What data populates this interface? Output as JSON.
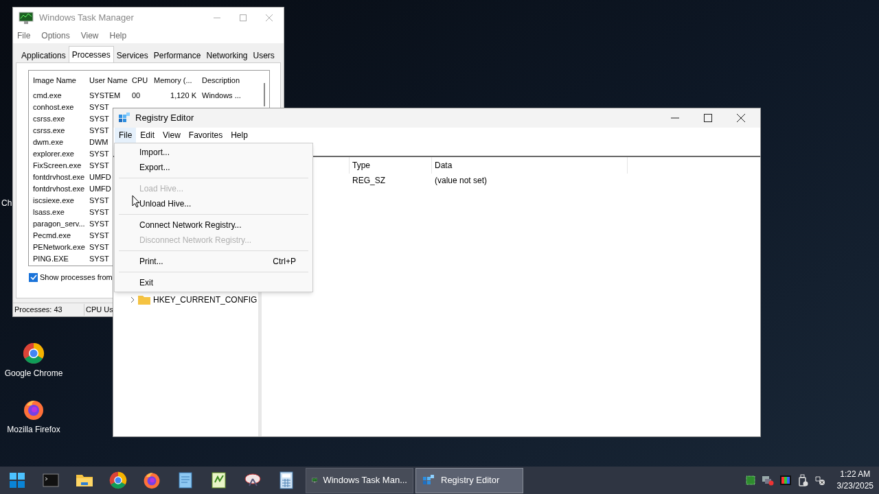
{
  "desktop": {
    "icons": [
      {
        "label": "Ch",
        "kind": "partial"
      },
      {
        "label": "Google Chrome",
        "kind": "chrome"
      },
      {
        "label": "Mozilla Firefox",
        "kind": "firefox"
      }
    ]
  },
  "task_manager": {
    "title": "Windows Task Manager",
    "menu": [
      "File",
      "Options",
      "View",
      "Help"
    ],
    "tabs": [
      {
        "label": "Applications",
        "selected": false
      },
      {
        "label": "Processes",
        "selected": true
      },
      {
        "label": "Services",
        "selected": false
      },
      {
        "label": "Performance",
        "selected": false
      },
      {
        "label": "Networking",
        "selected": false
      },
      {
        "label": "Users",
        "selected": false
      }
    ],
    "columns": [
      "Image Name",
      "User Name",
      "CPU",
      "Memory (...",
      "Description"
    ],
    "rows": [
      [
        "cmd.exe",
        "SYSTEM",
        "00",
        "1,120 K",
        "Windows ..."
      ],
      [
        "conhost.exe",
        "SYST"
      ],
      [
        "csrss.exe",
        "SYST"
      ],
      [
        "csrss.exe",
        "SYST"
      ],
      [
        "dwm.exe",
        "DWM"
      ],
      [
        "explorer.exe",
        "SYST"
      ],
      [
        "FixScreen.exe",
        "SYST"
      ],
      [
        "fontdrvhost.exe",
        "UMFD"
      ],
      [
        "fontdrvhost.exe",
        "UMFD"
      ],
      [
        "iscsiexe.exe",
        "SYST"
      ],
      [
        "lsass.exe",
        "SYST"
      ],
      [
        "paragon_serv...",
        "SYST"
      ],
      [
        "Pecmd.exe",
        "SYST"
      ],
      [
        "PENetwork.exe",
        "SYST"
      ],
      [
        "PING.EXE",
        "SYST"
      ]
    ],
    "show_all": {
      "label": "Show processes from",
      "checked": true
    },
    "status": [
      "Processes: 43",
      "CPU Us"
    ]
  },
  "registry": {
    "title": "Registry Editor",
    "menu": [
      {
        "label": "File",
        "selected": true
      },
      {
        "label": "Edit",
        "selected": false
      },
      {
        "label": "View",
        "selected": false
      },
      {
        "label": "Favorites",
        "selected": false
      },
      {
        "label": "Help",
        "selected": false
      }
    ],
    "file_menu": [
      {
        "kind": "item",
        "label": "Import...",
        "disabled": false
      },
      {
        "kind": "item",
        "label": "Export...",
        "disabled": false
      },
      {
        "kind": "separator"
      },
      {
        "kind": "item",
        "label": "Load Hive...",
        "disabled": true
      },
      {
        "kind": "item",
        "label": "Unload Hive...",
        "disabled": false
      },
      {
        "kind": "separator"
      },
      {
        "kind": "item",
        "label": "Connect Network Registry...",
        "disabled": false
      },
      {
        "kind": "item",
        "label": "Disconnect Network Registry...",
        "disabled": true
      },
      {
        "kind": "separator"
      },
      {
        "kind": "item",
        "label": "Print...",
        "shortcut": "Ctrl+P",
        "disabled": false
      },
      {
        "kind": "separator"
      },
      {
        "kind": "item",
        "label": "Exit",
        "disabled": false
      }
    ],
    "tree": [
      {
        "label": "HKEY_CURRENT_CONFIG",
        "expanded": false
      }
    ],
    "columns": [
      "Type",
      "Data"
    ],
    "rows": [
      [
        "REG_SZ",
        "(value not set)"
      ]
    ]
  },
  "taskbar": {
    "pinned": [
      {
        "kind": "start"
      },
      {
        "kind": "terminal"
      },
      {
        "kind": "folder"
      },
      {
        "kind": "chrome"
      },
      {
        "kind": "firefox"
      },
      {
        "kind": "notepad"
      },
      {
        "kind": "editor"
      },
      {
        "kind": "dish"
      },
      {
        "kind": "calculator"
      }
    ],
    "tasks": [
      {
        "label": "Windows Task Man...",
        "kind": "taskmgr",
        "selected": false
      },
      {
        "label": "Registry Editor",
        "kind": "regedit",
        "selected": true
      }
    ],
    "tray": [
      {
        "kind": "chip"
      },
      {
        "kind": "network-error"
      },
      {
        "kind": "color"
      },
      {
        "kind": "usb"
      },
      {
        "kind": "network-off"
      }
    ],
    "time": "1:22 AM",
    "date": "3/23/2025"
  }
}
